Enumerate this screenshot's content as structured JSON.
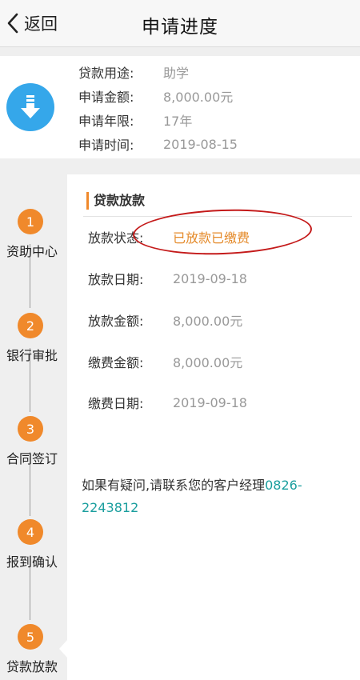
{
  "header": {
    "back_label": "返回",
    "title": "申请进度"
  },
  "summary": {
    "icon": "download-icon",
    "rows": [
      {
        "label": "贷款用途:",
        "value": "助学"
      },
      {
        "label": "申请金额:",
        "value": "8,000.00元"
      },
      {
        "label": "申请年限:",
        "value": "17年"
      },
      {
        "label": "申请时间:",
        "value": "2019-08-15"
      }
    ]
  },
  "steps": [
    {
      "number": "1",
      "label": "资助中心"
    },
    {
      "number": "2",
      "label": "银行审批"
    },
    {
      "number": "3",
      "label": "合同签订"
    },
    {
      "number": "4",
      "label": "报到确认"
    },
    {
      "number": "5",
      "label": "贷款放款"
    }
  ],
  "detail": {
    "section_title": "贷款放款",
    "rows": [
      {
        "label": "放款状态:",
        "value": "已放款已缴费"
      },
      {
        "label": "放款日期:",
        "value": "2019-09-18"
      },
      {
        "label": "放款金额:",
        "value": "8,000.00元"
      },
      {
        "label": "缴费金额:",
        "value": "8,000.00元"
      },
      {
        "label": "缴费日期:",
        "value": "2019-09-18"
      }
    ],
    "contact_text": "如果有疑问,请联系您的客户经理",
    "contact_phone": "0826-2243812"
  },
  "colors": {
    "accent": "#f0892b",
    "icon_blue": "#35a7ea",
    "annotation_red": "#c41a1a",
    "phone": "#1a9e9e"
  }
}
